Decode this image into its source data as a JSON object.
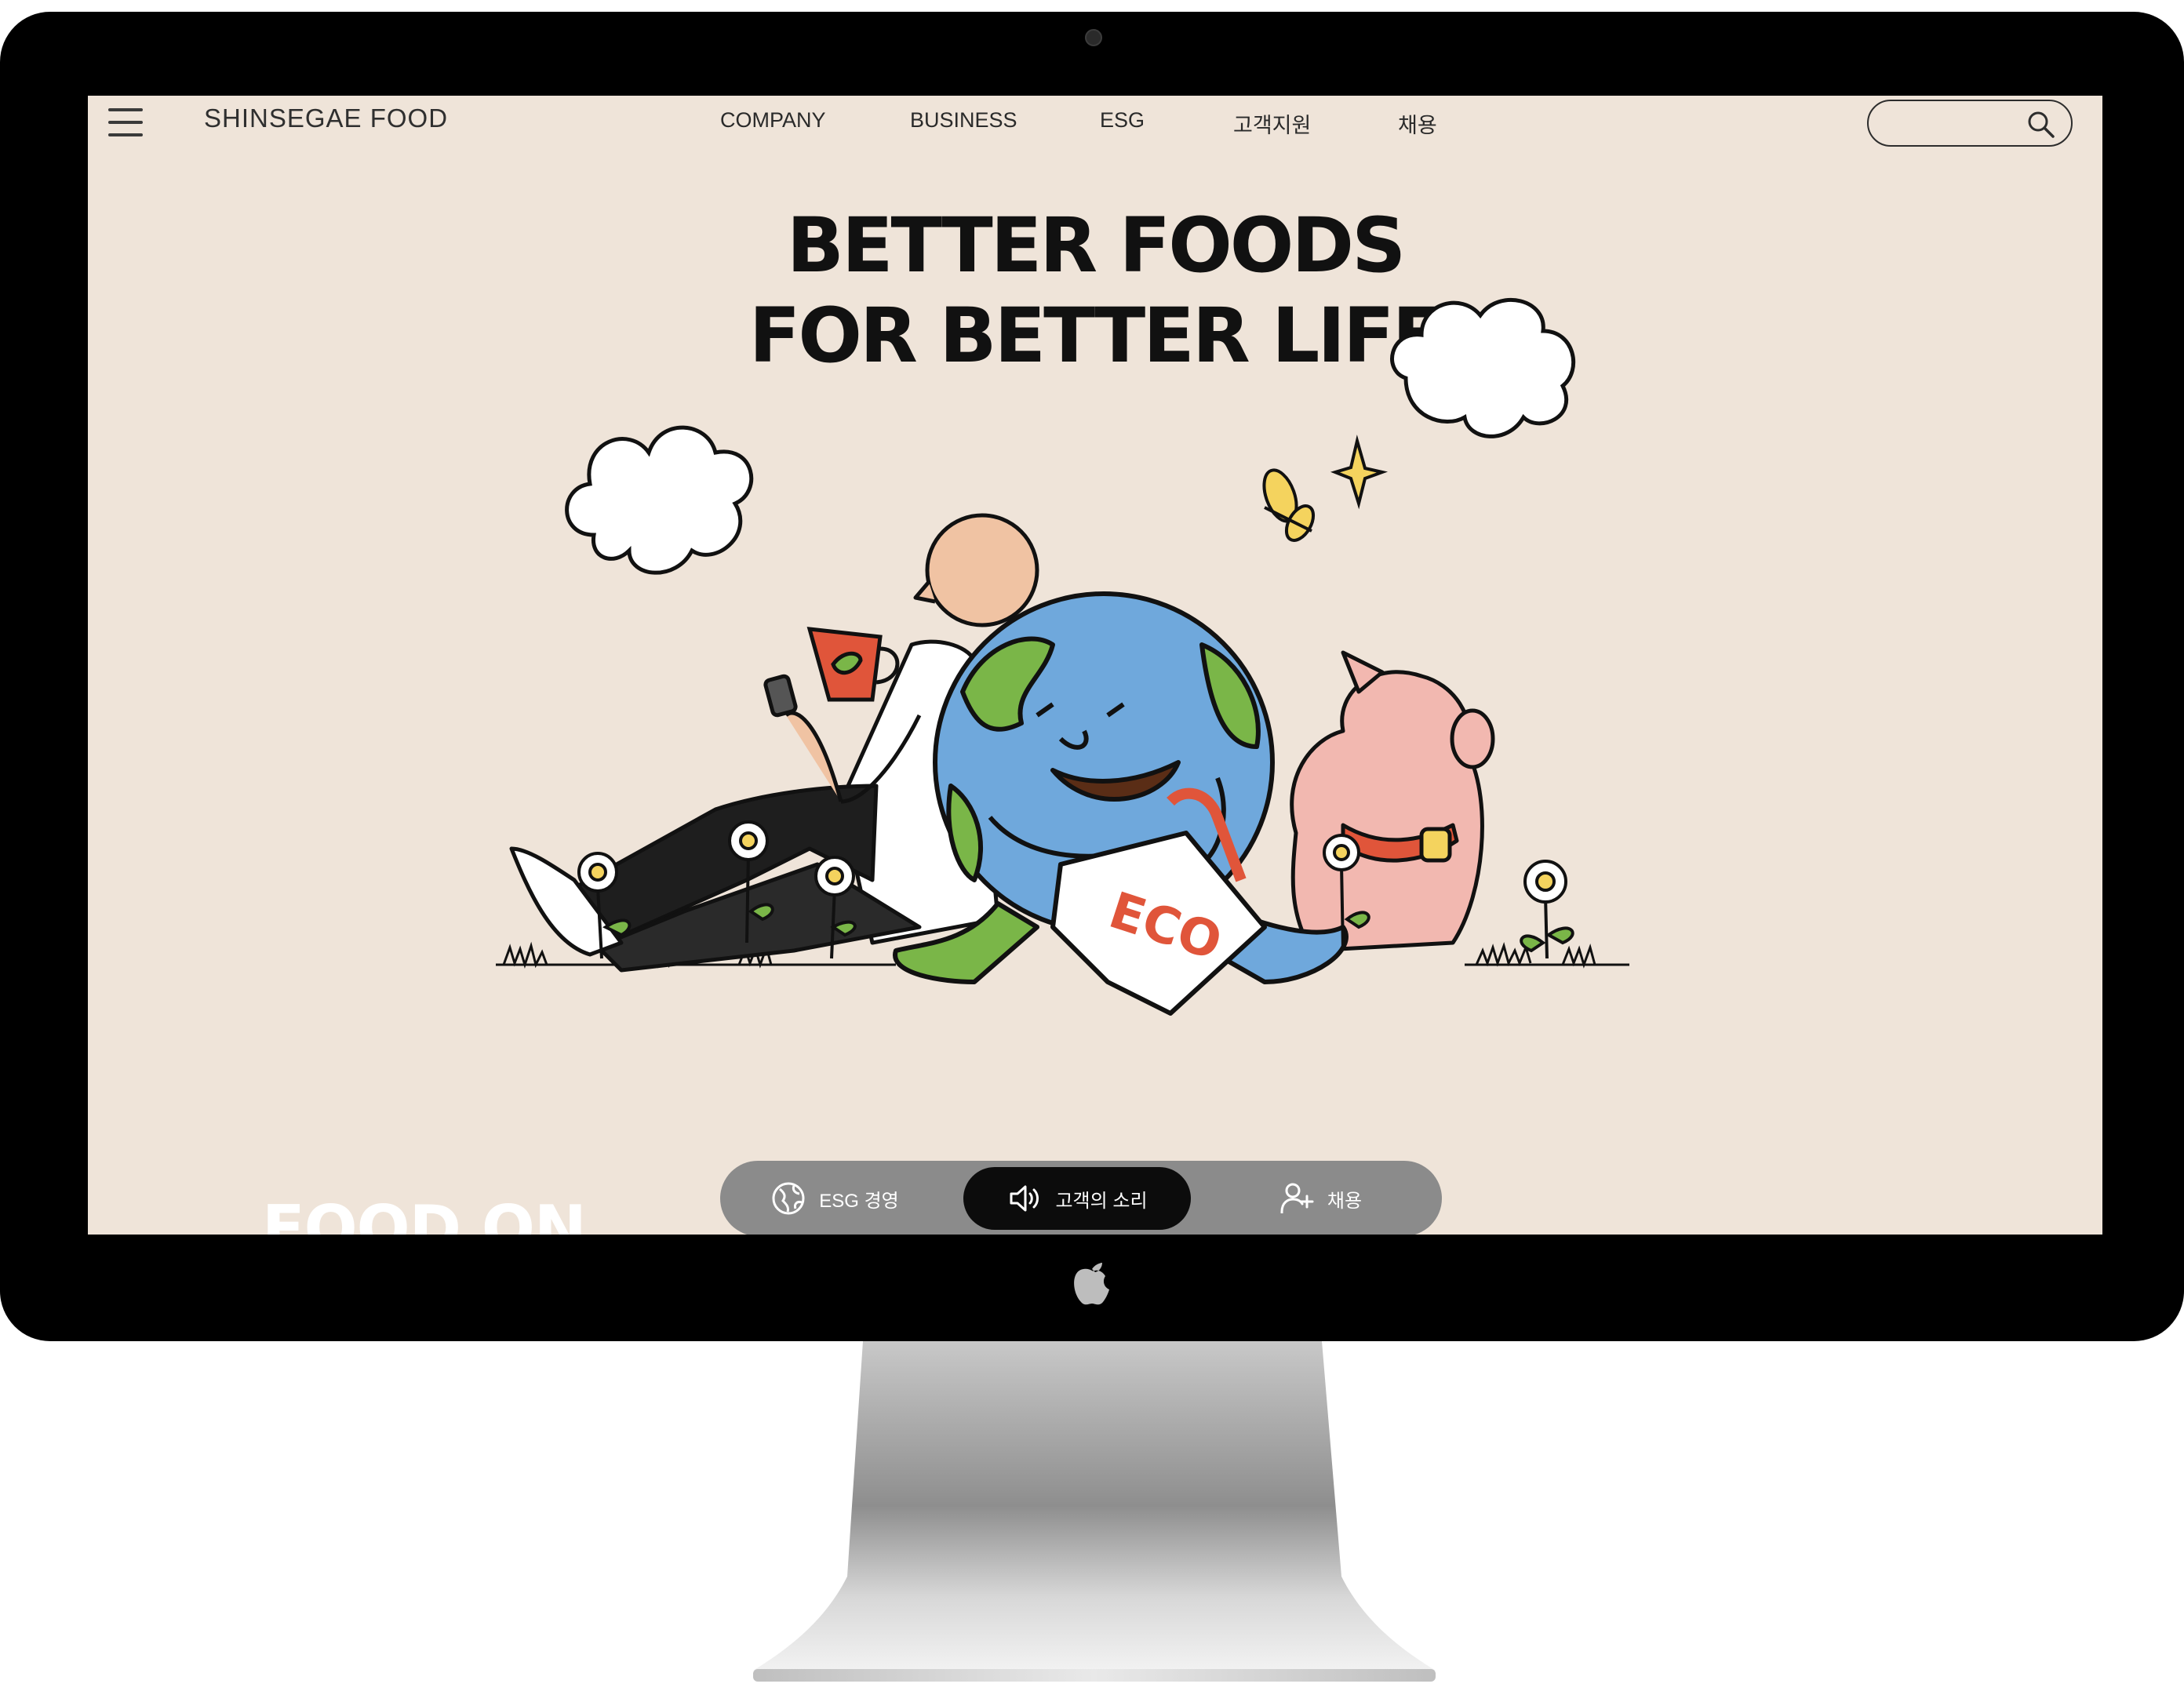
{
  "header": {
    "brand": "SHINSEGAE FOOD",
    "nav": [
      {
        "label": "COMPANY"
      },
      {
        "label": "BUSINESS"
      },
      {
        "label": "ESG"
      },
      {
        "label": "고객지원"
      },
      {
        "label": "채용"
      }
    ],
    "search": {
      "value": "",
      "placeholder": ""
    }
  },
  "hero": {
    "headline_line1": "BETTER FOODS",
    "headline_line2": "FOR BETTER LIFE",
    "bag_text": "ECO",
    "next_section_peek": "FOOD ON"
  },
  "quick_menu": {
    "items": [
      {
        "label": "ESG 경영",
        "icon": "globe-icon",
        "active": false
      },
      {
        "label": "고객의 소리",
        "icon": "speaker-icon",
        "active": true
      },
      {
        "label": "채용",
        "icon": "user-add-icon",
        "active": false
      }
    ]
  },
  "colors": {
    "page_background": "#efe4d9",
    "quickbar": "#8b8b8b",
    "quickbar_active": "#0c0c0c",
    "earth_ocean": "#6fa8dc",
    "earth_land": "#7ab648",
    "pig": "#f2b8b0",
    "mug": "#e0553a"
  }
}
